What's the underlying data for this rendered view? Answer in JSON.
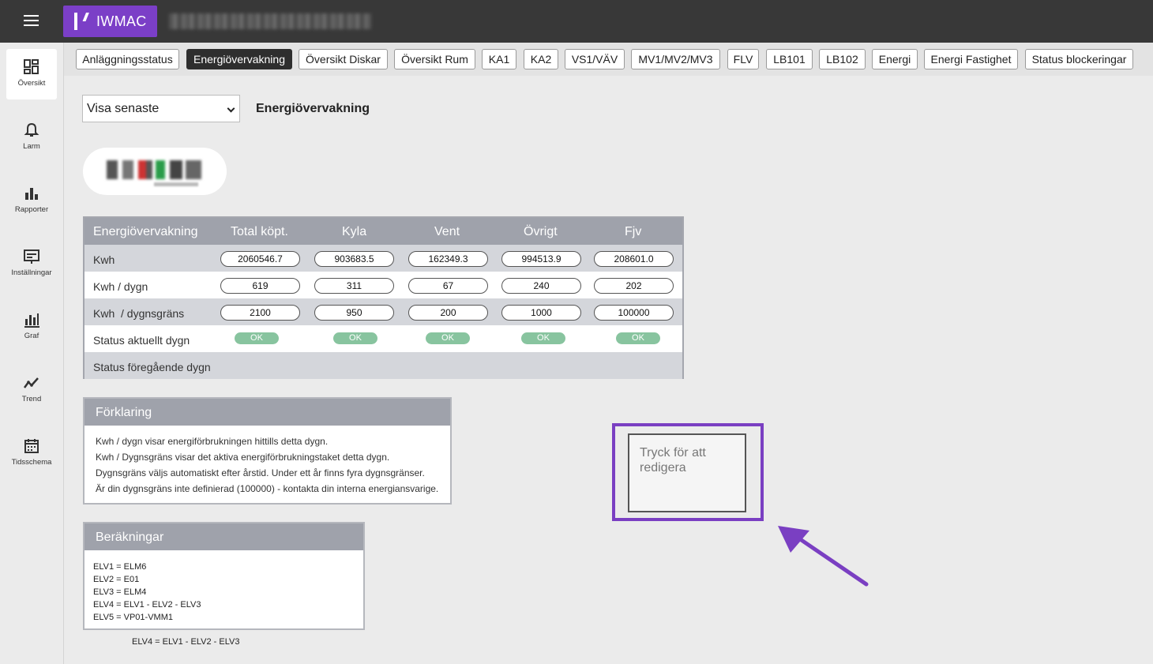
{
  "app": {
    "brand": "IWMAC",
    "brand_color": "#7b3fc7",
    "menu_icon": "hamburger-icon"
  },
  "sidebar": {
    "items": [
      {
        "label": "Översikt",
        "icon": "dashboard-icon",
        "active": true
      },
      {
        "label": "Larm",
        "icon": "bell-icon"
      },
      {
        "label": "Rapporter",
        "icon": "bar-chart-icon"
      },
      {
        "label": "Inställningar",
        "icon": "settings-panel-icon"
      },
      {
        "label": "Graf",
        "icon": "graph-icon"
      },
      {
        "label": "Trend",
        "icon": "trend-line-icon"
      },
      {
        "label": "Tidsschema",
        "icon": "calendar-icon"
      }
    ]
  },
  "tabs": [
    {
      "label": "Anläggningsstatus"
    },
    {
      "label": "Energiövervakning",
      "active": true
    },
    {
      "label": "Översikt Diskar"
    },
    {
      "label": "Översikt Rum"
    },
    {
      "label": "KA1"
    },
    {
      "label": "KA2"
    },
    {
      "label": "VS1/VÄV"
    },
    {
      "label": "MV1/MV2/MV3"
    },
    {
      "label": "FLV"
    },
    {
      "label": "LB101"
    },
    {
      "label": "LB102"
    },
    {
      "label": "Energi"
    },
    {
      "label": "Energi Fastighet"
    },
    {
      "label": "Status blockeringar"
    }
  ],
  "main": {
    "select_value": "Visa senaste",
    "heading": "Energiövervakning"
  },
  "table": {
    "headers": [
      "Energiövervakning",
      "Total köpt.",
      "Kyla",
      "Vent",
      "Övrigt",
      "Fjv"
    ],
    "rows": [
      {
        "label": "Kwh",
        "values": [
          "2060546.7",
          "903683.5",
          "162349.3",
          "994513.9",
          "208601.0"
        ]
      },
      {
        "label": "Kwh / dygn",
        "values": [
          "619",
          "311",
          "67",
          "240",
          "202"
        ]
      },
      {
        "label": "Kwh  / dygnsgräns",
        "values": [
          "2100",
          "950",
          "200",
          "1000",
          "100000"
        ]
      },
      {
        "label": "Status aktuellt dygn",
        "status": [
          "OK",
          "OK",
          "OK",
          "OK",
          "OK"
        ]
      },
      {
        "label": "Status föregående dygn"
      }
    ],
    "status_color": "#88c49f"
  },
  "explanation": {
    "title": "Förklaring",
    "lines": [
      "Kwh / dygn visar energiförbrukningen hittills detta dygn.",
      "Kwh / Dygnsgräns visar det aktiva energiförbrukningstaket detta dygn.",
      "Dygnsgräns väljs automatiskt efter årstid. Under ett år finns fyra dygnsgränser.",
      "Är din dygnsgräns inte definierad (100000) - kontakta din interna energiansvarige."
    ]
  },
  "calculations": {
    "title": "Beräkningar",
    "lines": [
      "ELV1 = ELM6",
      "ELV2 = E01",
      "ELV3 = ELM4",
      "ELV4 = ELV1 - ELV2 - ELV3",
      "ELV5 = VP01-VMM1"
    ],
    "note_below": "ELV4 = ELV1 - ELV2 - ELV3"
  },
  "edit_box": {
    "placeholder": "Tryck för att redigera",
    "highlight_color": "#7a3fc2"
  }
}
